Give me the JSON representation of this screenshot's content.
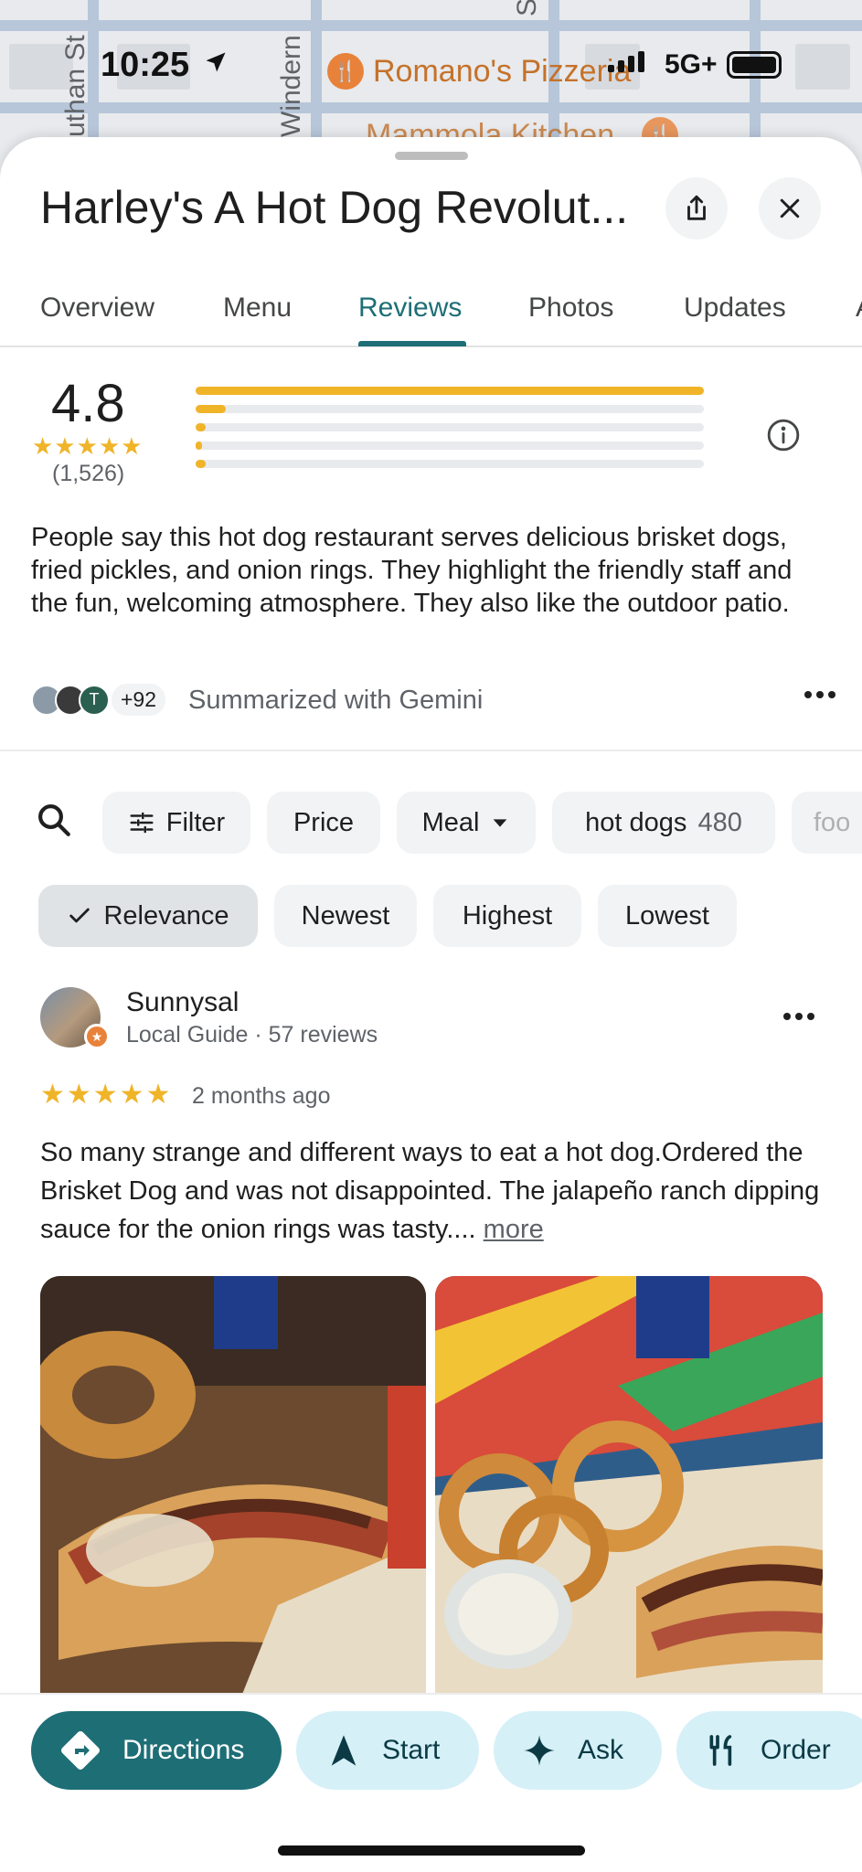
{
  "status_bar": {
    "time": "10:25",
    "network": "5G+"
  },
  "map": {
    "street_1": "uthan St",
    "street_2": "Windern",
    "street_3": "S",
    "poi_1": "Romano's Pizzeria",
    "poi_2": "Mammola Kitchen"
  },
  "place": {
    "title": "Harley's A Hot Dog Revolut..."
  },
  "tabs": [
    {
      "label": "Overview"
    },
    {
      "label": "Menu"
    },
    {
      "label": "Reviews"
    },
    {
      "label": "Photos"
    },
    {
      "label": "Updates"
    },
    {
      "label": "A"
    }
  ],
  "rating": {
    "score": "4.8",
    "stars": "★★★★★",
    "count": "(1,526)",
    "distribution": [
      {
        "stars": 5,
        "fraction": 1.0
      },
      {
        "stars": 4,
        "fraction": 0.06
      },
      {
        "stars": 3,
        "fraction": 0.02
      },
      {
        "stars": 2,
        "fraction": 0.01
      },
      {
        "stars": 1,
        "fraction": 0.02
      }
    ]
  },
  "summary": {
    "text": "People say this hot dog restaurant serves delicious brisket dogs, fried pickles, and onion rings. They highlight the friendly staff and the fun, welcoming atmosphere. They also like the outdoor patio.",
    "avatar_letter": "T",
    "more_count": "+92",
    "source": "Summarized with Gemini"
  },
  "filters": {
    "filter_label": "Filter",
    "price_label": "Price",
    "meal_label": "Meal",
    "topic_label": "hot dogs",
    "topic_count": "480",
    "partial_label": "foo"
  },
  "sort": {
    "relevance": "Relevance",
    "newest": "Newest",
    "highest": "Highest",
    "lowest": "Lowest"
  },
  "review": {
    "author": "Sunnysal",
    "meta": "Local Guide · 57 reviews",
    "stars": "★★★★★",
    "rating": 5,
    "date": "2 months ago",
    "text": "So many strange and different ways to eat a hot dog.Ordered the Brisket Dog and was not disappointed. The jalapeño ranch dipping sauce for the onion rings was tasty....",
    "more": "more"
  },
  "actions": {
    "directions": "Directions",
    "start": "Start",
    "ask": "Ask",
    "order": "Order"
  },
  "colors": {
    "accent": "#1e6e76",
    "star": "#f0b429",
    "secondary_action_bg": "#d6f0f8",
    "poi": "#e8823a"
  }
}
